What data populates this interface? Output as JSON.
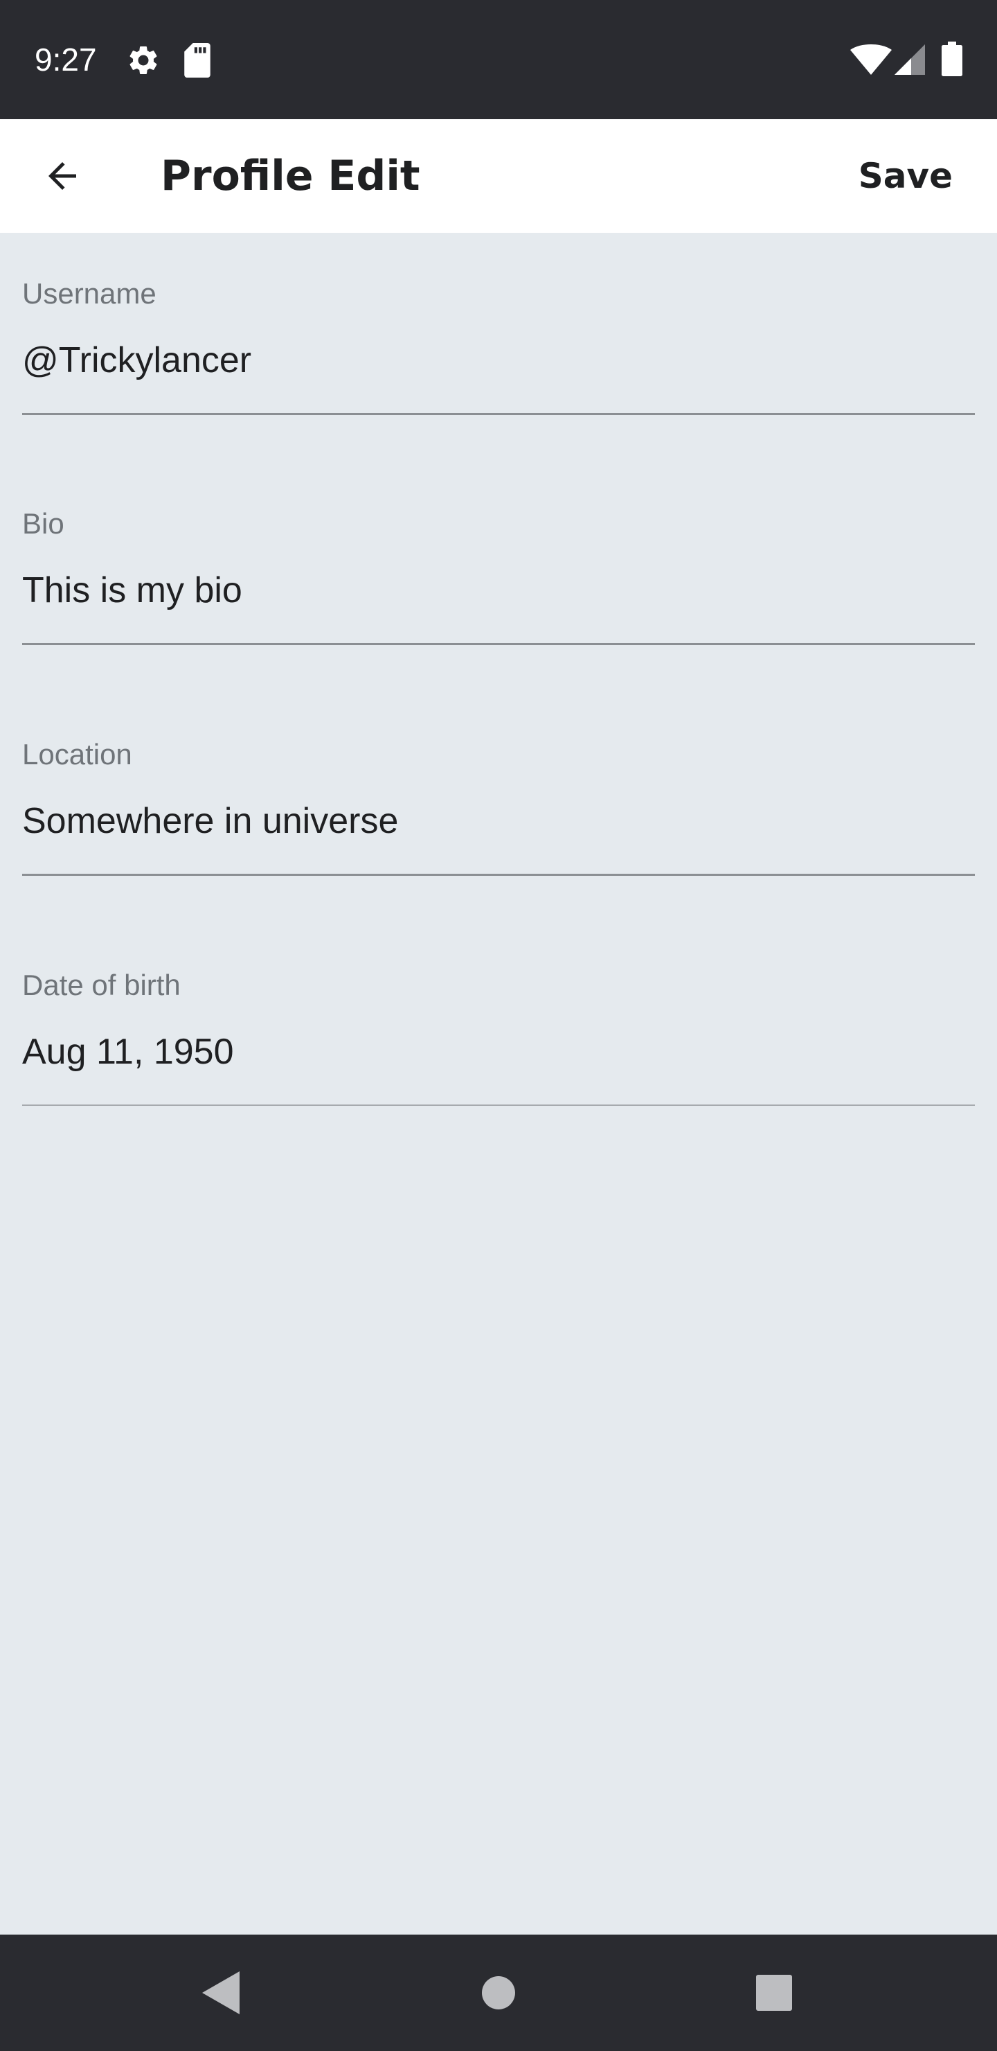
{
  "status_bar": {
    "time": "9:27",
    "icons": [
      "gear-icon",
      "sd-card-icon",
      "wifi-icon",
      "signal-icon",
      "battery-icon"
    ]
  },
  "app_bar": {
    "back_icon": "arrow-back-icon",
    "title": "Profile Edit",
    "save_label": "Save"
  },
  "form": {
    "username": {
      "label": "Username",
      "value": "@Trickylancer"
    },
    "bio": {
      "label": "Bio",
      "value": "This is my bio"
    },
    "location": {
      "label": "Location",
      "value": "Somewhere in universe"
    },
    "dob": {
      "label": "Date of birth",
      "value": "Aug 11, 1950"
    }
  },
  "nav_bar": {
    "icons": [
      "nav-back-icon",
      "nav-home-icon",
      "nav-recents-icon"
    ]
  },
  "colors": {
    "status_bar_bg": "#2a2b30",
    "app_bar_bg": "#ffffff",
    "page_bg": "#e5eaee",
    "label": "#6f7479",
    "text": "#1f2022"
  }
}
